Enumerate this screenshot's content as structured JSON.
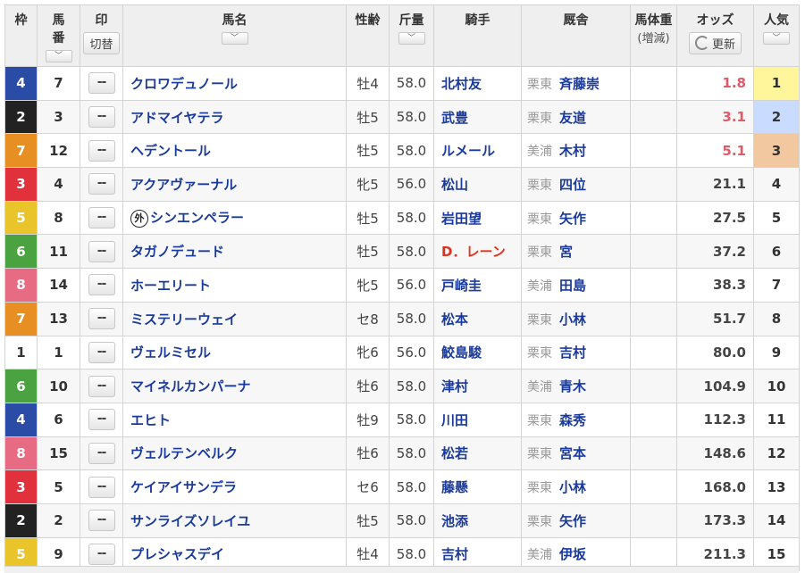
{
  "header": {
    "waku": "枠",
    "umaban_l1": "馬",
    "umaban_l2": "番",
    "shirushi": "印",
    "kirikae": "切替",
    "name": "馬名",
    "seirei": "性齢",
    "kinryo": "斤量",
    "kishu": "騎手",
    "kyusha": "厩舎",
    "bataiju": "馬体重",
    "zogen": "(増減)",
    "odds": "オッズ",
    "koshin": "更新",
    "ninki": "人気",
    "sort_glyph": "﹀"
  },
  "colors": {
    "waku1": "#ffffff",
    "waku2": "#222222",
    "waku3": "#e0313d",
    "waku4": "#2b4ca6",
    "waku5": "#e9c42a",
    "waku6": "#4aa340",
    "waku7": "#e88f23",
    "waku8": "#e76b82",
    "pop1": "#fff59a",
    "pop2": "#c9dcff",
    "pop3": "#f1c8a0"
  },
  "rows": [
    {
      "waku": "4",
      "uma": "7",
      "mark": "--",
      "name": "クロワデュノール",
      "gai": "",
      "sex": "牡4",
      "kin": "58.0",
      "jockey": "北村友",
      "jred": false,
      "region": "栗東",
      "trainer": "斉藤崇",
      "odds": "1.8",
      "pop": "1"
    },
    {
      "waku": "2",
      "uma": "3",
      "mark": "--",
      "name": "アドマイヤテラ",
      "gai": "",
      "sex": "牡5",
      "kin": "58.0",
      "jockey": "武豊",
      "jred": false,
      "region": "栗東",
      "trainer": "友道",
      "odds": "3.1",
      "pop": "2"
    },
    {
      "waku": "7",
      "uma": "12",
      "mark": "--",
      "name": "ヘデントール",
      "gai": "",
      "sex": "牡5",
      "kin": "58.0",
      "jockey": "ルメール",
      "jred": false,
      "region": "美浦",
      "trainer": "木村",
      "odds": "5.1",
      "pop": "3"
    },
    {
      "waku": "3",
      "uma": "4",
      "mark": "--",
      "name": "アクアヴァーナル",
      "gai": "",
      "sex": "牝5",
      "kin": "56.0",
      "jockey": "松山",
      "jred": false,
      "region": "栗東",
      "trainer": "四位",
      "odds": "21.1",
      "pop": "4"
    },
    {
      "waku": "5",
      "uma": "8",
      "mark": "--",
      "name": "シンエンペラー",
      "gai": "外",
      "sex": "牡5",
      "kin": "58.0",
      "jockey": "岩田望",
      "jred": false,
      "region": "栗東",
      "trainer": "矢作",
      "odds": "27.5",
      "pop": "5"
    },
    {
      "waku": "6",
      "uma": "11",
      "mark": "--",
      "name": "タガノデュード",
      "gai": "",
      "sex": "牡5",
      "kin": "58.0",
      "jockey": "D．レーン",
      "jred": true,
      "region": "栗東",
      "trainer": "宮",
      "odds": "37.2",
      "pop": "6"
    },
    {
      "waku": "8",
      "uma": "14",
      "mark": "--",
      "name": "ホーエリート",
      "gai": "",
      "sex": "牝5",
      "kin": "56.0",
      "jockey": "戸崎圭",
      "jred": false,
      "region": "美浦",
      "trainer": "田島",
      "odds": "38.3",
      "pop": "7"
    },
    {
      "waku": "7",
      "uma": "13",
      "mark": "--",
      "name": "ミステリーウェイ",
      "gai": "",
      "sex": "セ8",
      "kin": "58.0",
      "jockey": "松本",
      "jred": false,
      "region": "栗東",
      "trainer": "小林",
      "odds": "51.7",
      "pop": "8"
    },
    {
      "waku": "1",
      "uma": "1",
      "mark": "--",
      "name": "ヴェルミセル",
      "gai": "",
      "sex": "牝6",
      "kin": "56.0",
      "jockey": "鮫島駿",
      "jred": false,
      "region": "栗東",
      "trainer": "吉村",
      "odds": "80.0",
      "pop": "9"
    },
    {
      "waku": "6",
      "uma": "10",
      "mark": "--",
      "name": "マイネルカンパーナ",
      "gai": "",
      "sex": "牡6",
      "kin": "58.0",
      "jockey": "津村",
      "jred": false,
      "region": "美浦",
      "trainer": "青木",
      "odds": "104.9",
      "pop": "10"
    },
    {
      "waku": "4",
      "uma": "6",
      "mark": "--",
      "name": "エヒト",
      "gai": "",
      "sex": "牡9",
      "kin": "58.0",
      "jockey": "川田",
      "jred": false,
      "region": "栗東",
      "trainer": "森秀",
      "odds": "112.3",
      "pop": "11"
    },
    {
      "waku": "8",
      "uma": "15",
      "mark": "--",
      "name": "ヴェルテンベルク",
      "gai": "",
      "sex": "牡6",
      "kin": "58.0",
      "jockey": "松若",
      "jred": false,
      "region": "栗東",
      "trainer": "宮本",
      "odds": "148.6",
      "pop": "12"
    },
    {
      "waku": "3",
      "uma": "5",
      "mark": "--",
      "name": "ケイアイサンデラ",
      "gai": "",
      "sex": "セ6",
      "kin": "58.0",
      "jockey": "藤懸",
      "jred": false,
      "region": "栗東",
      "trainer": "小林",
      "odds": "168.0",
      "pop": "13"
    },
    {
      "waku": "2",
      "uma": "2",
      "mark": "--",
      "name": "サンライズソレイユ",
      "gai": "",
      "sex": "牡5",
      "kin": "58.0",
      "jockey": "池添",
      "jred": false,
      "region": "栗東",
      "trainer": "矢作",
      "odds": "173.3",
      "pop": "14"
    },
    {
      "waku": "5",
      "uma": "9",
      "mark": "--",
      "name": "プレシャスデイ",
      "gai": "",
      "sex": "牡4",
      "kin": "58.0",
      "jockey": "吉村",
      "jred": false,
      "region": "美浦",
      "trainer": "伊坂",
      "odds": "211.3",
      "pop": "15"
    }
  ]
}
